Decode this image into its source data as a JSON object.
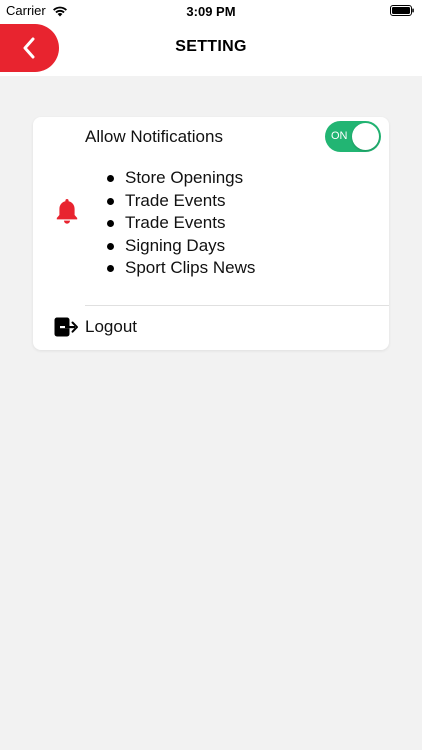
{
  "status_bar": {
    "carrier": "Carrier",
    "time": "3:09 PM",
    "icons": [
      "wifi-icon",
      "battery-icon"
    ]
  },
  "header": {
    "title": "SETTING",
    "back_icon": "chevron-left-icon"
  },
  "settings": {
    "notifications_label": "Allow Notifications",
    "toggle_label": "ON",
    "toggle_on": true,
    "bell_icon": "bell-icon",
    "topics": [
      "Store Openings",
      "Trade Events",
      "Trade Events",
      "Signing Days",
      "Sport Clips News"
    ],
    "logout_label": "Logout",
    "logout_icon": "logout-icon"
  },
  "colors": {
    "accent_red": "#e8242f",
    "toggle_green": "#22b573",
    "background": "#f2f2f2",
    "card": "#ffffff"
  }
}
